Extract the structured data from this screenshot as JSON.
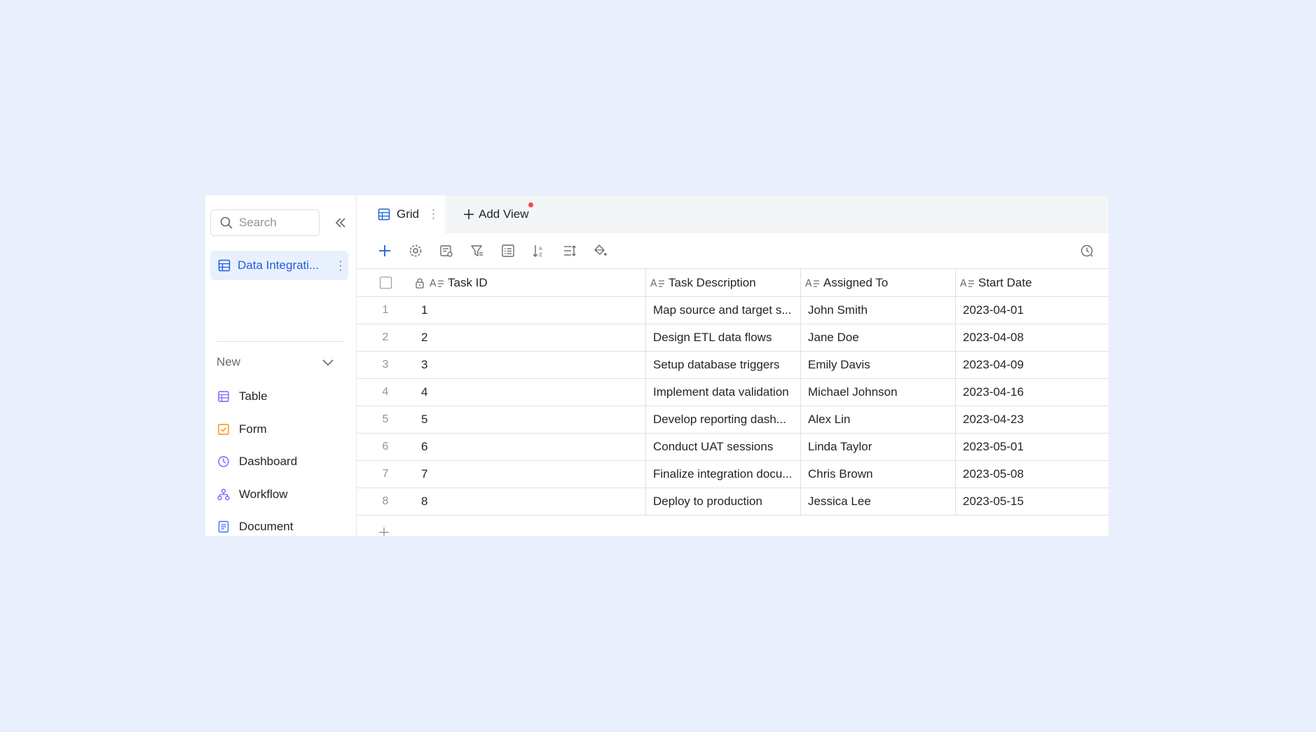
{
  "sidebar": {
    "search_placeholder": "Search",
    "active_item": {
      "label": "Data Integrati...",
      "icon": "table-icon",
      "more": "⋮"
    },
    "new_label": "New",
    "items": [
      {
        "label": "Table",
        "icon": "table-icon",
        "color": "#7b61ff"
      },
      {
        "label": "Form",
        "icon": "form-icon",
        "color": "#ff8800"
      },
      {
        "label": "Dashboard",
        "icon": "dashboard-icon",
        "color": "#7b61ff"
      },
      {
        "label": "Workflow",
        "icon": "workflow-icon",
        "color": "#7b61ff"
      },
      {
        "label": "Document",
        "icon": "document-icon",
        "color": "#3370ff"
      }
    ]
  },
  "tabs": {
    "grid_label": "Grid",
    "grid_more": "⋮",
    "add_view_label": "Add View"
  },
  "toolbar": {
    "icons": [
      "add-icon",
      "settings-icon",
      "field-config-icon",
      "filter-icon",
      "group-icon",
      "sort-icon",
      "row-height-icon",
      "fill-color-icon"
    ],
    "right_icons": [
      "history-icon",
      "checklist-icon"
    ]
  },
  "grid": {
    "columns": [
      "Task ID",
      "Task Description",
      "Assigned To",
      "Start Date"
    ],
    "rows": [
      {
        "num": "1",
        "id": "1",
        "desc": "Map source and target s...",
        "assigned": "John Smith",
        "date": "2023-04-01"
      },
      {
        "num": "2",
        "id": "2",
        "desc": "Design ETL data flows",
        "assigned": "Jane Doe",
        "date": "2023-04-08"
      },
      {
        "num": "3",
        "id": "3",
        "desc": "Setup database triggers",
        "assigned": "Emily Davis",
        "date": "2023-04-09"
      },
      {
        "num": "4",
        "id": "4",
        "desc": "Implement data validation",
        "assigned": "Michael Johnson",
        "date": "2023-04-16"
      },
      {
        "num": "5",
        "id": "5",
        "desc": "Develop reporting dash...",
        "assigned": "Alex Lin",
        "date": "2023-04-23"
      },
      {
        "num": "6",
        "id": "6",
        "desc": "Conduct UAT sessions",
        "assigned": "Linda Taylor",
        "date": "2023-05-01"
      },
      {
        "num": "7",
        "id": "7",
        "desc": "Finalize integration docu...",
        "assigned": "Chris Brown",
        "date": "2023-05-08"
      },
      {
        "num": "8",
        "id": "8",
        "desc": "Deploy to production",
        "assigned": "Jessica Lee",
        "date": "2023-05-15"
      }
    ]
  },
  "colors": {
    "accent": "#1e5fd9",
    "background": "#e9effc",
    "notification_dot": "#f54a45"
  }
}
